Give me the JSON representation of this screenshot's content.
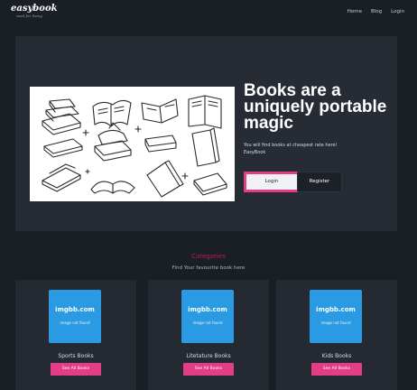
{
  "nav": {
    "logo": "easybook",
    "logo_tagline": "read for living",
    "links": [
      "Home",
      "Blog",
      "Login"
    ]
  },
  "hero": {
    "image_icon": "books-illustration",
    "title": "Books are a uniquely portable magic",
    "subtitle_line1": "You will find books at cheapest rate here!",
    "subtitle_line2": "EasyBook",
    "login_label": "Login",
    "register_label": "Register"
  },
  "categories": {
    "title": "Categories",
    "subtitle": "Find Your favourite book here",
    "placeholder_main": "imgbb.com",
    "placeholder_sub": "image not found",
    "items": [
      {
        "name": "Sports Books",
        "button": "See All Books"
      },
      {
        "name": "Litetature Books",
        "button": "See All Books"
      },
      {
        "name": "Kids Books",
        "button": "See All Books"
      }
    ]
  },
  "colors": {
    "accent": "#e23d86",
    "placeholder_bg": "#2a9be3",
    "page_bg": "#1a1e25",
    "panel_bg": "#272b33"
  }
}
